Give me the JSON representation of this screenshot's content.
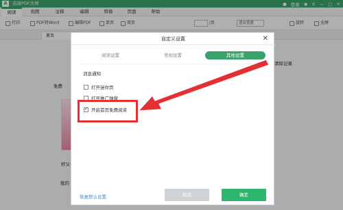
{
  "app": {
    "logo": "A",
    "name": "迅读PDF大师"
  },
  "titlebar": {
    "login": "登录",
    "icons": [
      "wechat-icon",
      "menu-icon",
      "minimize-icon",
      "maximize-icon",
      "close-icon"
    ]
  },
  "menu": {
    "tabs": [
      "阅读",
      "视图",
      "注释",
      "编辑",
      "转换",
      "页面",
      "帮助"
    ],
    "active": "阅读"
  },
  "toolbar": {
    "print": "打印",
    "pdf_to_word": "PDF转Word",
    "edit_pdf": "编辑PDF",
    "single_page": "单页",
    "double_page": "双页",
    "page_sep": "/页",
    "zoom": "适合宽度",
    "rotate": "旋转",
    "fullscreen": "全屏"
  },
  "doc_tab": {
    "label": "首页"
  },
  "background": {
    "free_section": "免费",
    "clear_history": "清除记录",
    "book_left_label": "好父母",
    "my_docs": "我的"
  },
  "dialog": {
    "title": "自定义设置",
    "tabs": [
      "阅读设置",
      "常规设置",
      "其他设置"
    ],
    "active_tab": "其他设置",
    "section_title": "消息通知",
    "options": [
      {
        "label": "打开迷你页",
        "checked": false
      },
      {
        "label": "打开推广弹窗",
        "checked": false
      },
      {
        "label": "开启首页免费阅读",
        "checked": true
      }
    ],
    "restore_defaults": "恢复默认设置",
    "cancel": "取消",
    "ok": "确定"
  },
  "colors": {
    "brand": "#3aa36b",
    "ok_button": "#2fb66e",
    "cancel_button": "#cfd3d5",
    "annotation": "#e23033",
    "link": "#2f8fd6"
  }
}
